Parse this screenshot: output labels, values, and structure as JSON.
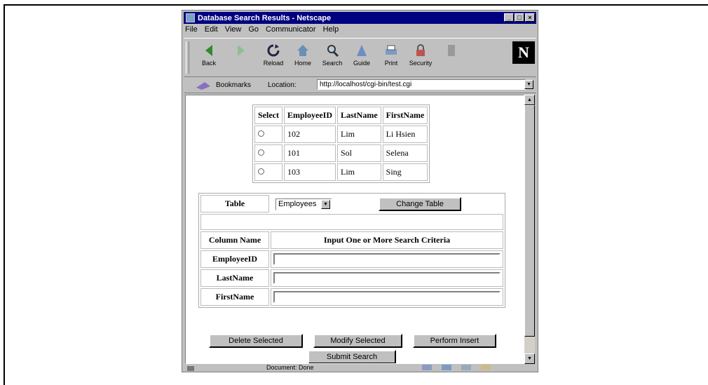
{
  "window": {
    "title": "Database Search Results - Netscape"
  },
  "menu": [
    "File",
    "Edit",
    "View",
    "Go",
    "Communicator",
    "Help"
  ],
  "toolbar": [
    "Back",
    "Forward",
    "Reload",
    "Home",
    "Search",
    "Guide",
    "Print",
    "Security",
    "Stop"
  ],
  "toolbar_visible_labels": [
    "Back",
    "Reload",
    "Home",
    "Search",
    "Guide",
    "Print",
    "Security"
  ],
  "location": {
    "bookmarks_label": "Bookmarks",
    "location_label": "Location:",
    "url": "http://localhost/cgi-bin/test.cgi"
  },
  "results": {
    "headers": [
      "Select",
      "EmployeeID",
      "LastName",
      "FirstName"
    ],
    "rows": [
      {
        "id": "102",
        "last": "Lim",
        "first": "Li Hsien"
      },
      {
        "id": "101",
        "last": "Sol",
        "first": "Selena"
      },
      {
        "id": "103",
        "last": "Lim",
        "first": "Sing"
      }
    ]
  },
  "search": {
    "table_label": "Table",
    "table_value": "Employees",
    "change_table_label": "Change Table",
    "col_header": "Column Name",
    "criteria_header": "Input One or More Search Criteria",
    "fields": [
      "EmployeeID",
      "LastName",
      "FirstName"
    ]
  },
  "actions": {
    "delete": "Delete Selected",
    "modify": "Modify Selected",
    "insert": "Perform Insert",
    "submit": "Submit Search"
  },
  "status": {
    "message": "Document: Done"
  },
  "logo": "N"
}
